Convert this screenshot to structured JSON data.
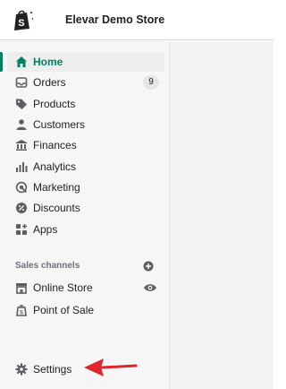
{
  "header": {
    "store_name": "Elevar Demo Store"
  },
  "nav": {
    "home": "Home",
    "orders": "Orders",
    "orders_badge": "9",
    "products": "Products",
    "customers": "Customers",
    "finances": "Finances",
    "analytics": "Analytics",
    "marketing": "Marketing",
    "discounts": "Discounts",
    "apps": "Apps"
  },
  "sales_channels": {
    "title": "Sales channels",
    "online_store": "Online Store",
    "point_of_sale": "Point of Sale"
  },
  "settings": {
    "label": "Settings"
  },
  "colors": {
    "accent": "#008060",
    "active_text": "#007f5f",
    "arrow": "#e0242b",
    "icon": "#5c5f62"
  }
}
